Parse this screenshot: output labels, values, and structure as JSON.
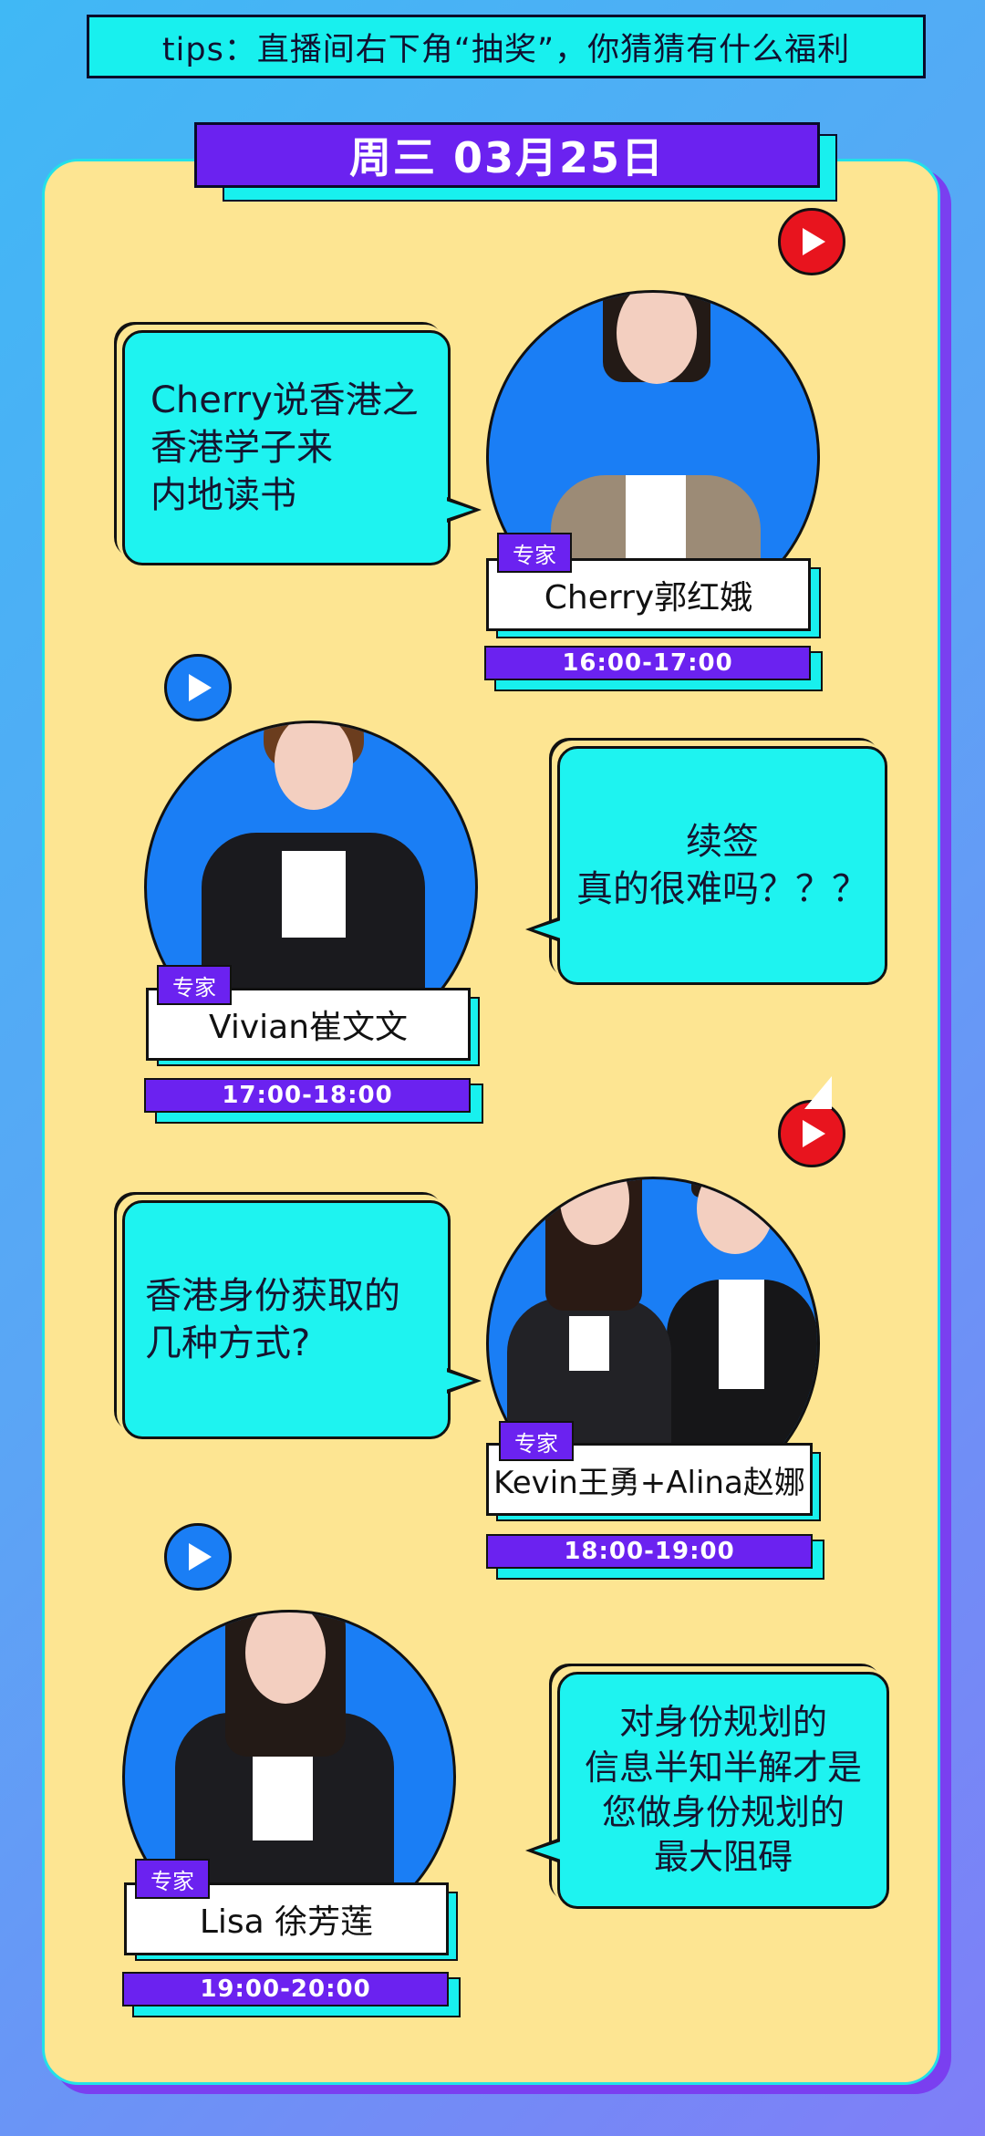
{
  "tips": "tips：直播间右下角“抽奖”，你猜猜有什么福利",
  "date_header": "周三 03月25日",
  "badge_label": "专家",
  "colors": {
    "accent_purple": "#6b22f0",
    "cyan": "#1ef3f0",
    "card_yellow": "#fde592",
    "circle_blue": "#1a7ef5",
    "play_red": "#e8141e"
  },
  "icons": {
    "play": "play-icon"
  },
  "sessions": [
    {
      "topic_lines": [
        "Cherry说香港之",
        "香港学子来",
        "内地读书"
      ],
      "expert_name": "Cherry郭红娥",
      "time": "16:00-17:00"
    },
    {
      "topic_lines": [
        "续签",
        "真的很难吗？？？"
      ],
      "expert_name": "Vivian崔文文",
      "time": "17:00-18:00"
    },
    {
      "topic_lines": [
        "香港身份获取的",
        "几种方式?"
      ],
      "expert_name": "Kevin王勇+Alina赵娜",
      "time": "18:00-19:00"
    },
    {
      "topic_lines": [
        "对身份规划的",
        "信息半知半解才是",
        "您做身份规划的",
        "最大阻碍"
      ],
      "expert_name": "Lisa 徐芳莲",
      "time": "19:00-20:00"
    }
  ]
}
